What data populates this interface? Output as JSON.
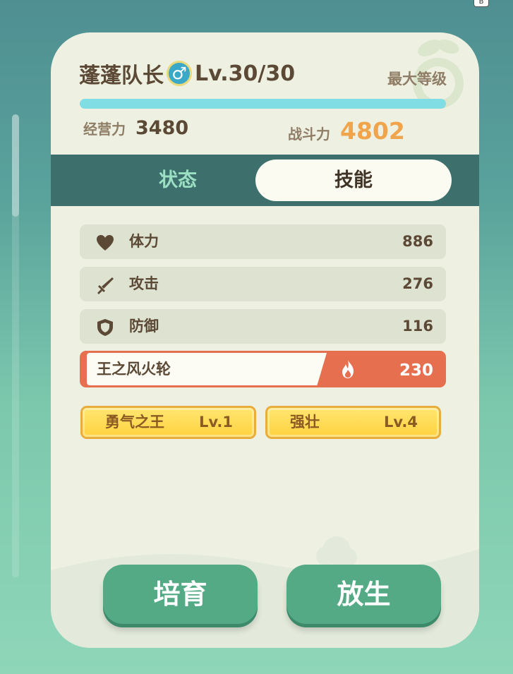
{
  "corner_badge": "B",
  "pet": {
    "name": "蓬蓬队长",
    "gender_symbol": "♂",
    "level_text": "Lv.30/30",
    "max_level_label": "最大等级",
    "exp_progress": 1.0
  },
  "summary": {
    "business_label": "经营力",
    "business_value": "3480",
    "combat_label": "战斗力",
    "combat_value": "4802"
  },
  "tabs": {
    "status": "状态",
    "skills": "技能",
    "active": "skills"
  },
  "stats": [
    {
      "label": "体力",
      "value": "886",
      "icon": "heart-icon"
    },
    {
      "label": "攻击",
      "value": "276",
      "icon": "sword-icon"
    },
    {
      "label": "防御",
      "value": "116",
      "icon": "shield-icon"
    }
  ],
  "special_skill": {
    "name": "王之风火轮",
    "value": "230",
    "icon": "fire-icon"
  },
  "skills": [
    {
      "name": "勇气之王",
      "level": "Lv.1"
    },
    {
      "name": "强壮",
      "level": "Lv.4"
    }
  ],
  "buttons": {
    "train": "培育",
    "release": "放生"
  },
  "colors": {
    "accent_orange": "#f0a54d",
    "skill_red": "#e56f4f",
    "button_green": "#53aa85",
    "tabbar": "#3d6f6c"
  }
}
